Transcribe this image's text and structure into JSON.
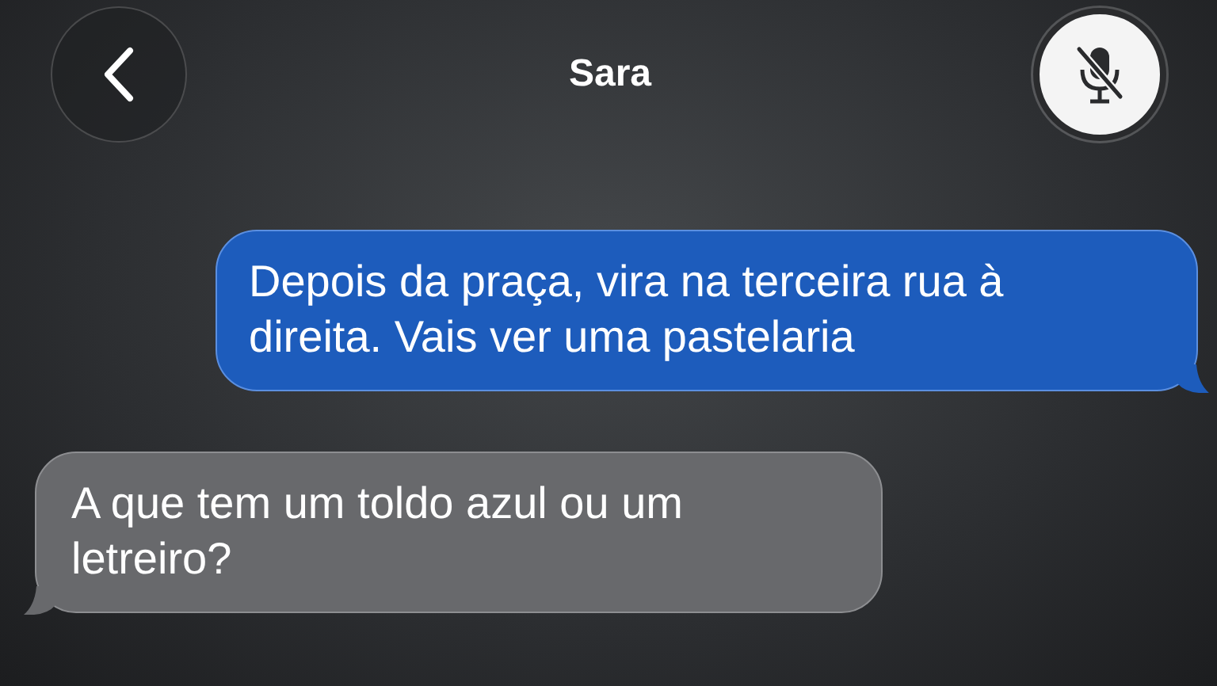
{
  "header": {
    "title": "Sara"
  },
  "messages": [
    {
      "kind": "sent",
      "text": "Depois da praça, vira na terceira rua à direita. Vais ver uma pastelaria"
    },
    {
      "kind": "received",
      "text": "A que tem um toldo azul ou um letreiro?"
    }
  ]
}
